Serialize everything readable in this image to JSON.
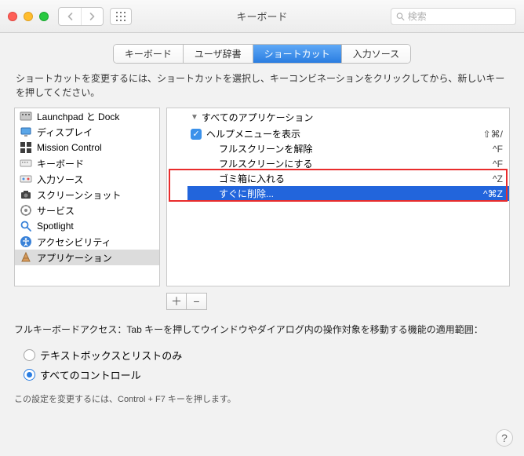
{
  "window": {
    "title": "キーボード"
  },
  "search": {
    "placeholder": "検索"
  },
  "tabs": [
    "キーボード",
    "ユーザ辞書",
    "ショートカット",
    "入力ソース"
  ],
  "active_tab": 2,
  "instruction": "ショートカットを変更するには、ショートカットを選択し、キーコンビネーションをクリックしてから、新しいキーを押してください。",
  "categories": [
    {
      "label": "Launchpad と Dock"
    },
    {
      "label": "ディスプレイ"
    },
    {
      "label": "Mission Control"
    },
    {
      "label": "キーボード"
    },
    {
      "label": "入力ソース"
    },
    {
      "label": "スクリーンショット"
    },
    {
      "label": "サービス"
    },
    {
      "label": "Spotlight"
    },
    {
      "label": "アクセシビリティ"
    },
    {
      "label": "アプリケーション",
      "selected": true
    }
  ],
  "tree": {
    "group_label": "すべてのアプリケーション",
    "group_checked": true,
    "items": [
      {
        "label": "ヘルプメニューを表示",
        "shortcut": "⇧⌘/",
        "checked": false
      },
      {
        "label": "フルスクリーンを解除",
        "shortcut": "^F",
        "checked": false
      },
      {
        "label": "フルスクリーンにする",
        "shortcut": "^F",
        "checked": false
      },
      {
        "label": "ゴミ箱に入れる",
        "shortcut": "^Z",
        "checked": false,
        "highlighted": true
      },
      {
        "label": "すぐに削除...",
        "shortcut": "^⌘Z",
        "checked": false,
        "selected": true,
        "highlighted": true
      }
    ]
  },
  "buttons": {
    "add": "＋",
    "remove": "−"
  },
  "fka": {
    "label": "フルキーボードアクセス：Tab キーを押してウインドウやダイアログ内の操作対象を移動する機能の適用範囲：",
    "options": [
      "テキストボックスとリストのみ",
      "すべてのコントロール"
    ],
    "selected": 1,
    "note": "この設定を変更するには、Control + F7 キーを押します。"
  },
  "help": "?"
}
